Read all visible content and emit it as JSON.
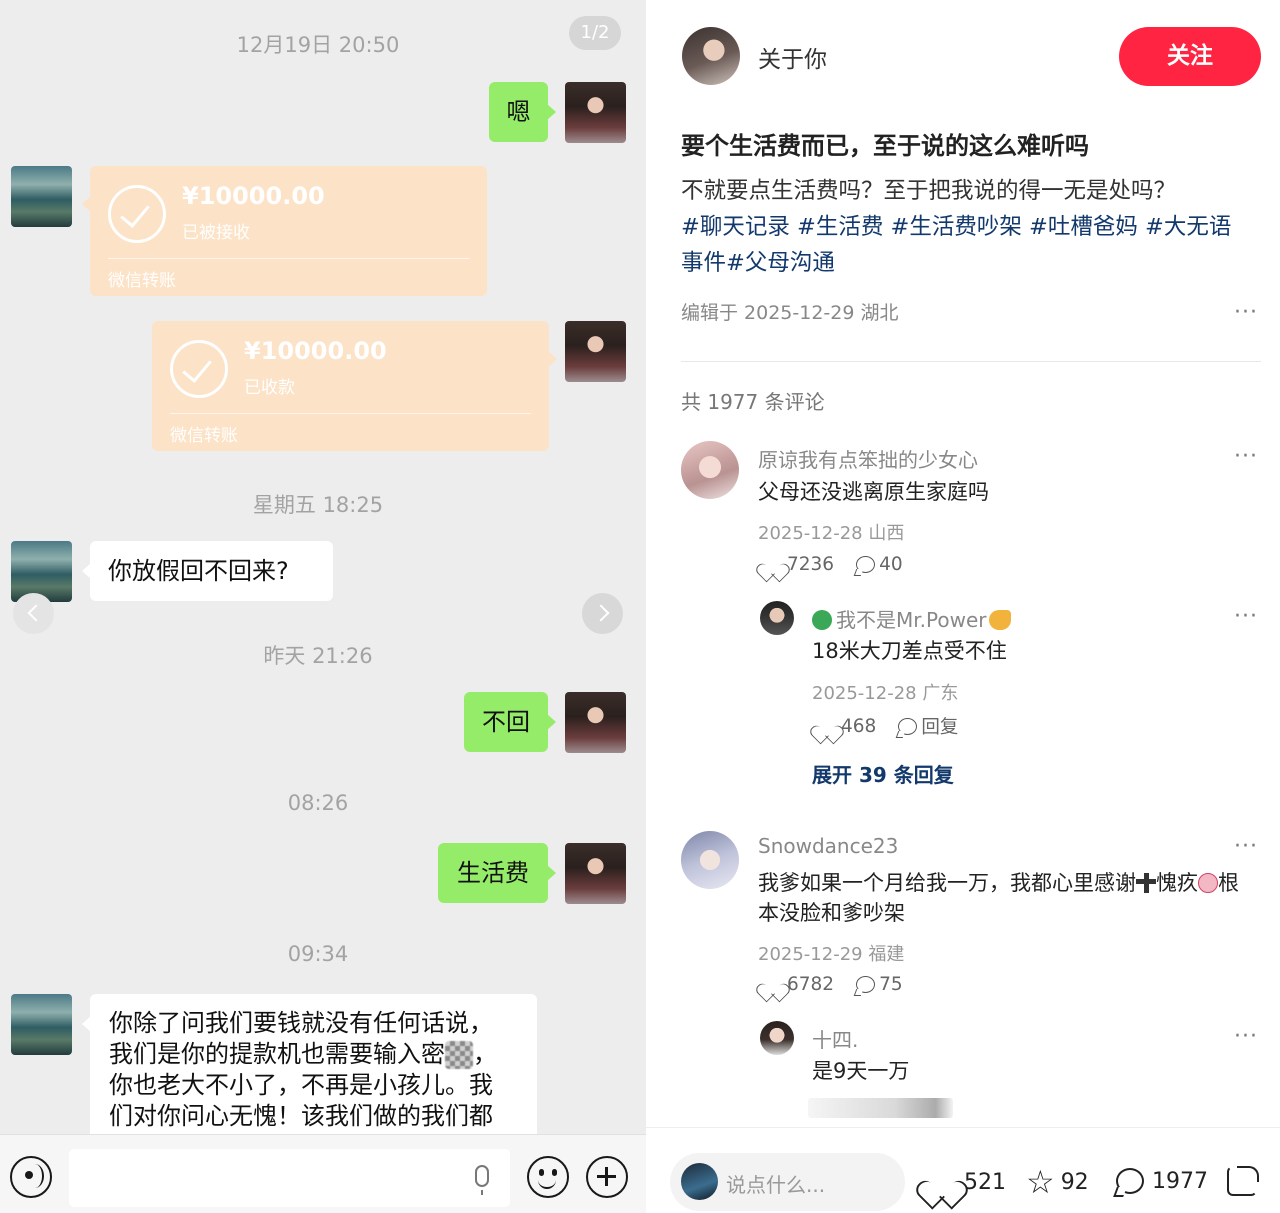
{
  "chat": {
    "page_indicator": "1/2",
    "timestamps": [
      "12月19日 20:50",
      "星期五 18:25",
      "昨天 21:26",
      "08:26",
      "09:34"
    ],
    "messages": {
      "m1": "嗯",
      "m2": "你放假回不回来?",
      "m3": "不回",
      "m4": "生活费",
      "m5_lines": [
        "你除了问我们要钱就没有任何话说，",
        "我们是你的提款机也需要输入密",
        "，",
        "你也老大不小了，不再是小孩儿。我",
        "们对你问心无愧！该我们做的我们都"
      ]
    },
    "transfers": [
      {
        "amount": "¥10000.00",
        "status": "已被接收",
        "label": "微信转账"
      },
      {
        "amount": "¥10000.00",
        "status": "已收款",
        "label": "微信转账"
      }
    ],
    "input_icons": [
      "voice-icon",
      "mic-icon",
      "emoji-icon",
      "plus-icon"
    ]
  },
  "post": {
    "author": "关于你",
    "follow_label": "关注",
    "title": "要个生活费而已，至于说的这么难听吗",
    "body": "不就要点生活费吗？至于把我说的得一无是处吗？",
    "tags": [
      "#聊天记录",
      "#生活费",
      "#生活费吵架",
      "#吐槽爸妈",
      "#大无语事件",
      "#父母沟通"
    ],
    "tags_line1": "#聊天记录 #生活费 #生活费吵架 #吐槽爸妈 #大无语",
    "tags_line2": "事件#父母沟通",
    "meta": "编辑于 2025-12-29 湖北",
    "more": "···",
    "comment_count_text": "共 1977 条评论"
  },
  "comments": [
    {
      "name": "原谅我有点笨拙的少女心",
      "text": "父母还没逃离原生家庭吗",
      "meta": "2025-12-28 山西",
      "likes": "7236",
      "replies": "40",
      "reply": {
        "name": "我不是Mr.Power",
        "text": "18米大刀差点受不住",
        "meta": "2025-12-28 广东",
        "likes": "468",
        "reply_label": "回复"
      },
      "expand": "展开 39 条回复"
    },
    {
      "name": "Snowdance23",
      "text_a": "我爹如果一个月给我一万，我都心里感谢",
      "text_b": "愧疚",
      "text_c": "根",
      "text_line2": "本没脸和爹吵架",
      "meta": "2025-12-29 福建",
      "likes": "6782",
      "replies": "75",
      "reply": {
        "name": "十四.",
        "text": "是9天一万"
      }
    }
  ],
  "bottom": {
    "placeholder": "说点什么...",
    "likes": "521",
    "stars": "92",
    "comments": "1977"
  },
  "colors": {
    "accent": "#ff2442",
    "tag": "#13386c",
    "chat_green": "#95ec69",
    "transfer": "#fce2c6"
  }
}
